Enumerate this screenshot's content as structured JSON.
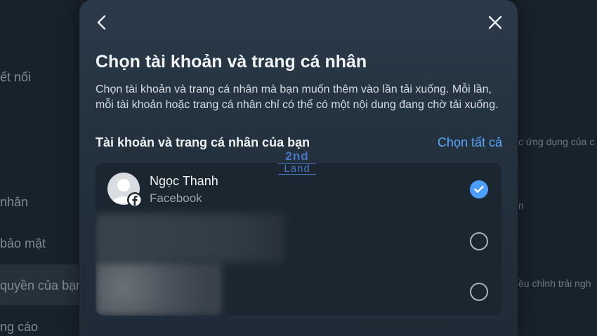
{
  "background": {
    "left_items": [
      "ết nối",
      "nhân",
      "bảo mật",
      "quyền của bạn",
      "ng cáo"
    ],
    "right_items": [
      "c ứng dụng của c",
      "n",
      "ều chỉnh trải ngh"
    ]
  },
  "modal": {
    "title": "Chọn tài khoản và trang cá nhân",
    "description": "Chọn tài khoản và trang cá nhân mà bạn muốn thêm vào lần tải xuống. Mỗi lần, mỗi tài khoản hoặc trang cá nhân chỉ có thể có một nội dung đang chờ tải xuống.",
    "section_title": "Tài khoản và trang cá nhân của bạn",
    "select_all": "Chọn tất cả",
    "accounts": [
      {
        "name": "Ngọc Thanh",
        "platform": "Facebook",
        "selected": true
      },
      {
        "name": "",
        "platform": "",
        "selected": false
      },
      {
        "name": "",
        "platform": "",
        "selected": false
      }
    ],
    "icons": {
      "back": "chevron-left-icon",
      "close": "close-icon",
      "badge": "facebook-icon",
      "check": "checkmark-icon"
    }
  },
  "watermark": {
    "line1": "2nd",
    "line2": "Land"
  },
  "colors": {
    "accent": "#5aa7ff",
    "check": "#4d9dff"
  }
}
